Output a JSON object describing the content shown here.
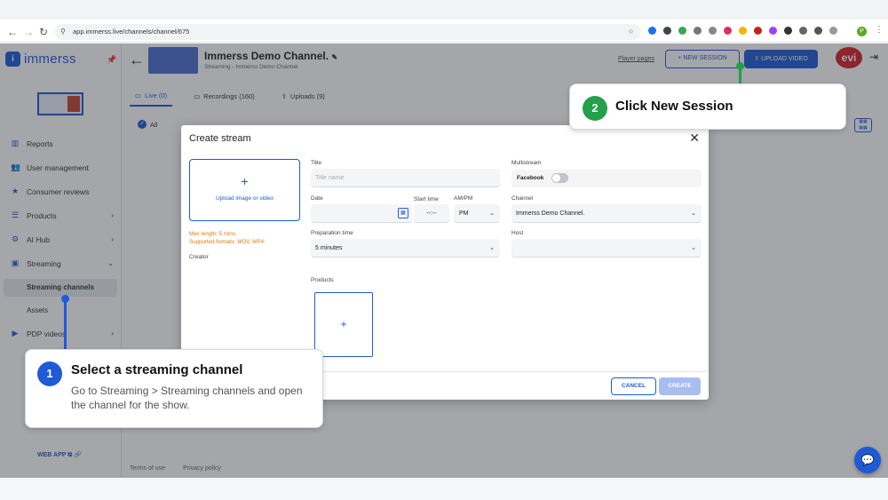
{
  "browser": {
    "url": "app.immerss.live/channels/channel/675",
    "back": "←",
    "forward": "→",
    "reload": "↻",
    "profile_initial": "P"
  },
  "sidebar": {
    "logo_mark": "i",
    "logo_text": "immerss",
    "items": [
      {
        "label": "Reports",
        "icon": "▥"
      },
      {
        "label": "User management",
        "icon": "👥"
      },
      {
        "label": "Consumer reviews",
        "icon": "★"
      },
      {
        "label": "Products",
        "icon": "☰"
      },
      {
        "label": "AI Hub",
        "icon": "⚙"
      },
      {
        "label": "Streaming",
        "icon": "▣"
      },
      {
        "label": "PDP videos",
        "icon": "▶"
      }
    ],
    "sub_items": [
      "Streaming channels",
      "Assets"
    ],
    "web_app": "WEB APP"
  },
  "header": {
    "title": "Immerss Demo Channel.",
    "subtitle": "Streaming - Immerss Demo Channel",
    "player_pages": "Player pages",
    "new_session": "+ NEW SESSION",
    "upload_video": "UPLOAD VIDEO",
    "brand_logo": "evi"
  },
  "tabs": [
    {
      "label": "Live (0)",
      "icon": "▭"
    },
    {
      "label": "Recordings (160)",
      "icon": "▭"
    },
    {
      "label": "Uploads (9)",
      "icon": "⇪"
    }
  ],
  "filters": {
    "all": "All"
  },
  "footer": {
    "terms": "Terms of use",
    "privacy": "Privacy policy"
  },
  "modal": {
    "title": "Create stream",
    "upload_label": "Upload image or video",
    "upload_note_1": "Max length: 5 mins.",
    "upload_note_2": "Supported formats: MOV, MP4.",
    "creator_label": "Creator",
    "title_label": "Title",
    "title_placeholder": "Title name",
    "date_label": "Date",
    "start_time_label": "Start time",
    "start_time_value": "--:--",
    "ampm_label": "AM/PM",
    "ampm_value": "PM",
    "prep_label": "Preparation time",
    "prep_value": "5 minutes",
    "multistream_label": "Multistream",
    "facebook_label": "Facebook",
    "facebook_enabled": false,
    "channel_label": "Channel",
    "channel_value": "Immerss Demo Channel.",
    "host_label": "Host",
    "host_value": "",
    "products_label": "Products",
    "cancel": "CANCEL",
    "create": "CREATE"
  },
  "callouts": [
    {
      "step": "1",
      "title": "Select a streaming channel",
      "desc": "Go to Streaming > Streaming channels and open the channel for the show.",
      "color": "#1f5ad7"
    },
    {
      "step": "2",
      "title": "Click New Session",
      "color": "#23a04a"
    }
  ]
}
